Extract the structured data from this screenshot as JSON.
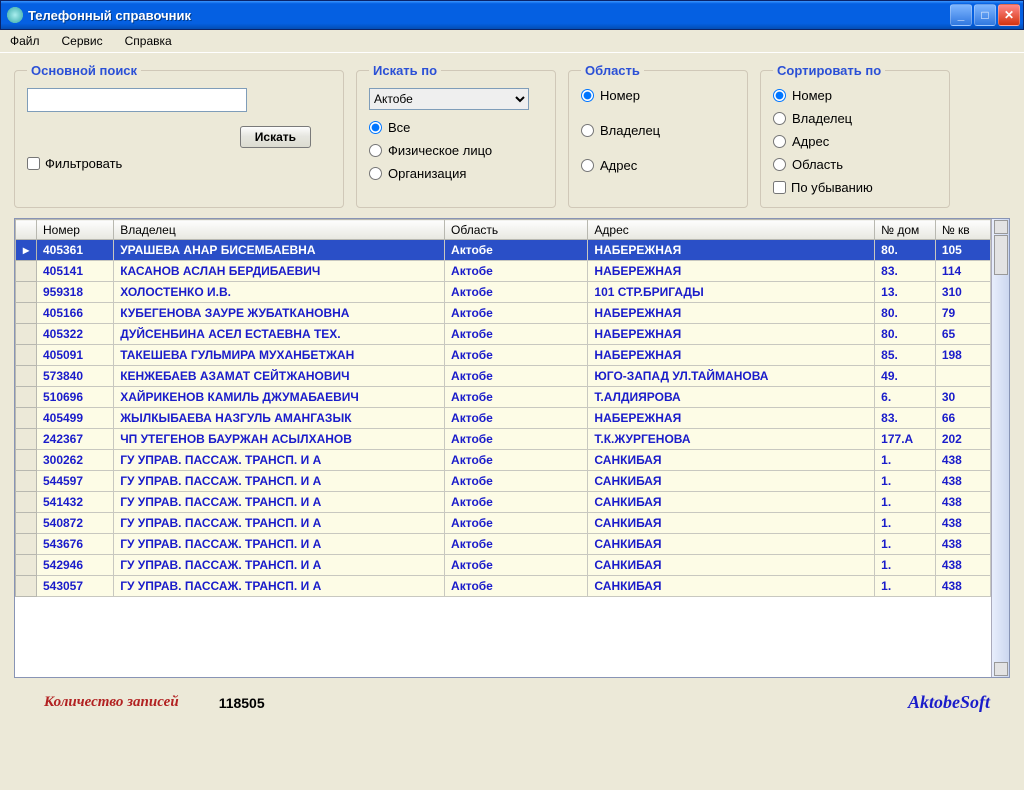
{
  "titlebar": {
    "title": "Телефонный справочник"
  },
  "menu": {
    "file": "Файл",
    "service": "Сервис",
    "help": "Справка"
  },
  "search_group": {
    "legend": "Основной поиск",
    "button": "Искать",
    "filter_label": "Фильтровать"
  },
  "searchby_group": {
    "legend": "Искать по",
    "selected_region": "Актобе",
    "all": "Все",
    "person": "Физическое лицо",
    "org": "Организация"
  },
  "area_group": {
    "legend": "Область",
    "number": "Номер",
    "owner": "Владелец",
    "address": "Адрес"
  },
  "sort_group": {
    "legend": "Сортировать по",
    "number": "Номер",
    "owner": "Владелец",
    "address": "Адрес",
    "region": "Область",
    "desc": "По убыванию"
  },
  "columns": {
    "number": "Номер",
    "owner": "Владелец",
    "region": "Область",
    "address": "Адрес",
    "house": "№ дом",
    "apt": "№ кв"
  },
  "rows": [
    {
      "number": "405361",
      "owner": "УРАШЕВА АНАР БИСЕМБАЕВНА",
      "region": "Актобе",
      "address": "НАБЕРЕЖНАЯ",
      "house": "80.",
      "apt": "105"
    },
    {
      "number": "405141",
      "owner": "КАСАНОВ АСЛАН БЕРДИБАЕВИЧ",
      "region": "Актобе",
      "address": "НАБЕРЕЖНАЯ",
      "house": "83.",
      "apt": "114"
    },
    {
      "number": "959318",
      "owner": "ХОЛОСТЕНКО И.В.",
      "region": "Актобе",
      "address": "101 СТР.БРИГАДЫ",
      "house": "13.",
      "apt": "310"
    },
    {
      "number": "405166",
      "owner": "КУБЕГЕНОВА ЗАУРЕ ЖУБАТКАНОВНА",
      "region": "Актобе",
      "address": "НАБЕРЕЖНАЯ",
      "house": "80.",
      "apt": "79"
    },
    {
      "number": "405322",
      "owner": "ДУЙСЕНБИНА АСЕЛ ЕСТАЕВНА ТЕХ.",
      "region": "Актобе",
      "address": "НАБЕРЕЖНАЯ",
      "house": "80.",
      "apt": "65"
    },
    {
      "number": "405091",
      "owner": "ТАКЕШЕВА ГУЛЬМИРА МУХАНБЕТЖАН",
      "region": "Актобе",
      "address": "НАБЕРЕЖНАЯ",
      "house": "85.",
      "apt": "198"
    },
    {
      "number": "573840",
      "owner": "КЕНЖЕБАЕВ АЗАМАТ СЕЙТЖАНОВИЧ",
      "region": "Актобе",
      "address": "ЮГО-ЗАПАД УЛ.ТАЙМАНОВА",
      "house": "49.",
      "apt": ""
    },
    {
      "number": "510696",
      "owner": "ХАЙРИКЕНОВ КАМИЛЬ ДЖУМАБАЕВИЧ",
      "region": "Актобе",
      "address": "Т.АЛДИЯРОВА",
      "house": "6.",
      "apt": "30"
    },
    {
      "number": "405499",
      "owner": "ЖЫЛКЫБАЕВА НАЗГУЛЬ АМАНГАЗЫК",
      "region": "Актобе",
      "address": "НАБЕРЕЖНАЯ",
      "house": "83.",
      "apt": "66"
    },
    {
      "number": "242367",
      "owner": "ЧП УТЕГЕНОВ БАУРЖАН АСЫЛХАНОВ",
      "region": "Актобе",
      "address": "Т.К.ЖУРГЕНОВА",
      "house": "177.А",
      "apt": "202"
    },
    {
      "number": "300262",
      "owner": "ГУ  УПРАВ. ПАССАЖ. ТРАНСП. И А",
      "region": "Актобе",
      "address": "САНКИБАЯ",
      "house": "1.",
      "apt": "438"
    },
    {
      "number": "544597",
      "owner": "ГУ  УПРАВ. ПАССАЖ. ТРАНСП. И А",
      "region": "Актобе",
      "address": "САНКИБАЯ",
      "house": "1.",
      "apt": "438"
    },
    {
      "number": "541432",
      "owner": "ГУ  УПРАВ. ПАССАЖ. ТРАНСП. И А",
      "region": "Актобе",
      "address": "САНКИБАЯ",
      "house": "1.",
      "apt": "438"
    },
    {
      "number": "540872",
      "owner": "ГУ  УПРАВ. ПАССАЖ. ТРАНСП. И А",
      "region": "Актобе",
      "address": "САНКИБАЯ",
      "house": "1.",
      "apt": "438"
    },
    {
      "number": "543676",
      "owner": "ГУ  УПРАВ. ПАССАЖ. ТРАНСП. И А",
      "region": "Актобе",
      "address": "САНКИБАЯ",
      "house": "1.",
      "apt": "438"
    },
    {
      "number": "542946",
      "owner": "ГУ  УПРАВ. ПАССАЖ. ТРАНСП. И А",
      "region": "Актобе",
      "address": "САНКИБАЯ",
      "house": "1.",
      "apt": "438"
    },
    {
      "number": "543057",
      "owner": "ГУ  УПРАВ. ПАССАЖ. ТРАНСП. И А",
      "region": "Актобе",
      "address": "САНКИБАЯ",
      "house": "1.",
      "apt": "438"
    }
  ],
  "footer": {
    "count_label": "Количество записей",
    "count_value": "118505",
    "brand": "AktobeSoft"
  }
}
